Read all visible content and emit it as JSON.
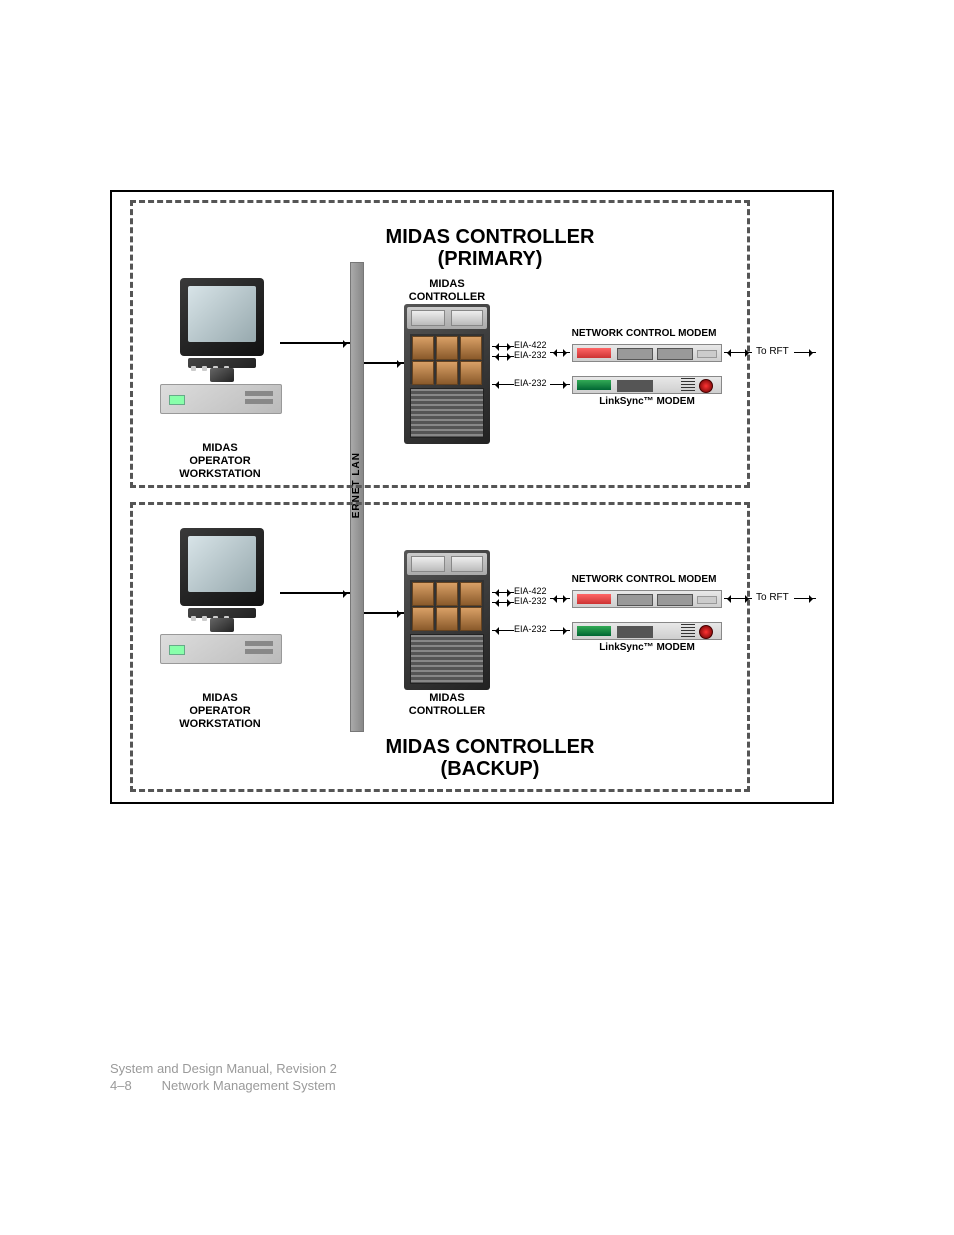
{
  "footer": {
    "line1": "System and Design Manual, Revision 2",
    "page_num": "4–8",
    "section": "Network Management System"
  },
  "diagram": {
    "lan_label": "ERNET LAN",
    "to_rft": "To RFT",
    "primary": {
      "title_line1": "MIDAS CONTROLLER",
      "title_line2": "(PRIMARY)",
      "workstation_label_l1": "MIDAS",
      "workstation_label_l2": "OPERATOR",
      "workstation_label_l3": "WORKSTATION",
      "controller_label_l1": "MIDAS",
      "controller_label_l2": "CONTROLLER",
      "ncm_label": "NETWORK CONTROL MODEM",
      "linksync_label": "LinkSync™ MODEM",
      "conn": {
        "eia422": "EIA-422",
        "eia232a": "EIA-232",
        "eia232b": "EIA-232"
      }
    },
    "backup": {
      "title_line1": "MIDAS CONTROLLER",
      "title_line2": "(BACKUP)",
      "workstation_label_l1": "MIDAS",
      "workstation_label_l2": "OPERATOR",
      "workstation_label_l3": "WORKSTATION",
      "controller_label_l1": "MIDAS",
      "controller_label_l2": "CONTROLLER",
      "ncm_label": "NETWORK CONTROL MODEM",
      "linksync_label": "LinkSync™ MODEM",
      "conn": {
        "eia422": "EIA-422",
        "eia232a": "EIA-232",
        "eia232b": "EIA-232"
      }
    }
  }
}
